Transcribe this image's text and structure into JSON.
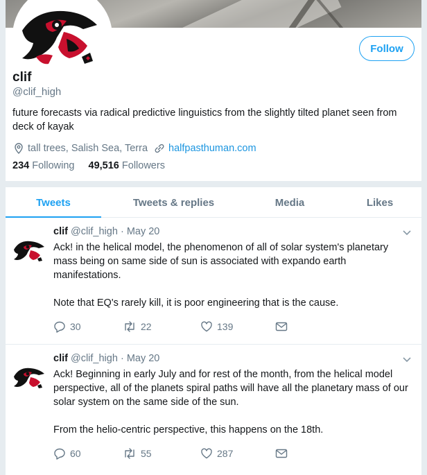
{
  "profile": {
    "name": "clif",
    "handle": "@clif_high",
    "follow_label": "Follow",
    "bio": "future forecasts via radical predictive linguistics from the slightly tilted planet seen from deck of kayak",
    "location": "tall trees, Salish Sea, Terra",
    "website": "halfpasthuman.com",
    "following_count": "234",
    "following_label": "Following",
    "followers_count": "49,516",
    "followers_label": "Followers"
  },
  "tabs": [
    {
      "label": "Tweets",
      "active": true
    },
    {
      "label": "Tweets & replies",
      "active": false
    },
    {
      "label": "Media",
      "active": false
    },
    {
      "label": "Likes",
      "active": false
    }
  ],
  "tweets": [
    {
      "name": "clif",
      "handle": "@clif_high",
      "separator": "·",
      "date": "May 20",
      "paragraphs": [
        "Ack! in the helical model, the phenomenon of all of solar system's planetary mass being on same side of sun is associated with expando earth manifestations.",
        "Note that EQ's rarely kill, it is poor engineering that is the cause."
      ],
      "replies": "30",
      "retweets": "22",
      "likes": "139"
    },
    {
      "name": "clif",
      "handle": "@clif_high",
      "separator": "·",
      "date": "May 20",
      "paragraphs": [
        "Ack! Beginning in early July and for rest of the month, from the helical model perspective, all of the planets spiral paths will have all the planetary mass of our solar system on the same side of the sun.",
        "From the helio-centric perspective, this happens on the 18th."
      ],
      "replies": "60",
      "retweets": "55",
      "likes": "287"
    }
  ],
  "colors": {
    "accent": "#1da1f2",
    "link": "#1b95e0",
    "muted": "#657786",
    "background": "#e6ecf0"
  },
  "icons": [
    "location-icon",
    "link-icon",
    "reply-icon",
    "retweet-icon",
    "like-icon",
    "message-icon",
    "chevron-down-icon"
  ]
}
